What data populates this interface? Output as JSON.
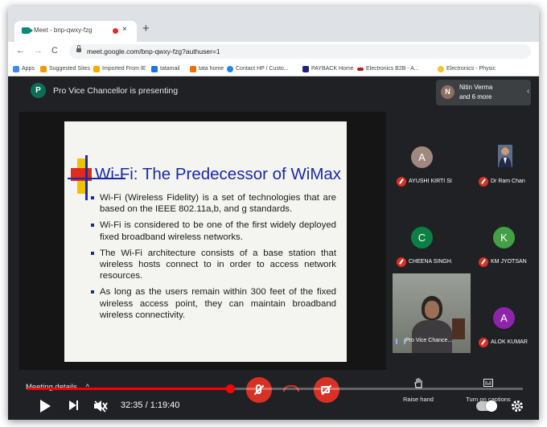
{
  "browser": {
    "tab_title": "Meet - bnp-qwxy-fzg",
    "tab_close": "×",
    "new_tab": "+",
    "url": "meet.google.com/bnp-qwxy-fzg?authuser=1",
    "nav_back": "←",
    "nav_forward": "→",
    "nav_reload": "C",
    "bookmarks": [
      {
        "label": "Apps",
        "color": "#4285f4"
      },
      {
        "label": "Suggested Sites",
        "color": "#f29900"
      },
      {
        "label": "Imported From IE",
        "color": "#f9ab00"
      },
      {
        "label": "tatamail",
        "color": "#1a73e8"
      },
      {
        "label": "tata home",
        "color": "#e8710a"
      },
      {
        "label": "Contact HP / Custo...",
        "color": "#1e88e5"
      },
      {
        "label": "PAYBACK Home",
        "color": "#1a237e"
      },
      {
        "label": "Electronics B2B - A...",
        "color": "#b71c1c"
      },
      {
        "label": "Electronics - Physic",
        "color": "#fbc02d"
      }
    ]
  },
  "meet": {
    "presenter_initial": "P",
    "presenter_text": "Pro Vice Chancellor is presenting",
    "people_initial": "N",
    "people_line1": "Nitin Verma",
    "people_line2": "and 6 more",
    "chevron": "‹"
  },
  "slide": {
    "title": "Wi-Fi: The Predecessor of WiMax",
    "bullets": [
      "Wi-Fi (Wireless Fidelity) is a set of technologies that are based on the IEEE 802.11a,b, and g standards.",
      "Wi-Fi is considered to be one of the first widely deployed fixed broadband wireless networks.",
      "The Wi-Fi architecture consists of a base station that wireless hosts connect to in order to access network resources.",
      "As long as the users remain within 300 feet of the fixed wireless access point, they can maintain broadband wireless connectivity."
    ]
  },
  "participants": [
    {
      "initial": "A",
      "name": "AYUSHI KIRTI SI...",
      "color": "#a1887f"
    },
    {
      "initial": "",
      "name": "Dr Ram Chan",
      "color": ""
    },
    {
      "initial": "C",
      "name": "CHEENA SINGH...",
      "color": "#0b8043"
    },
    {
      "initial": "K",
      "name": "KM JYOTSAN",
      "color": "#43a047"
    },
    {
      "initial": "A",
      "name": "ALOK KUMAR",
      "color": "#8e24aa"
    }
  ],
  "self_view": {
    "name": "Pro Vice Chance..."
  },
  "controls": {
    "meeting_details": "Meeting details",
    "meeting_details_chevron": "^",
    "raise_hand": "Raise hand",
    "captions": "Turn on captions"
  },
  "player": {
    "time": "32:35 / 1:19:40",
    "progress": 0.409
  }
}
